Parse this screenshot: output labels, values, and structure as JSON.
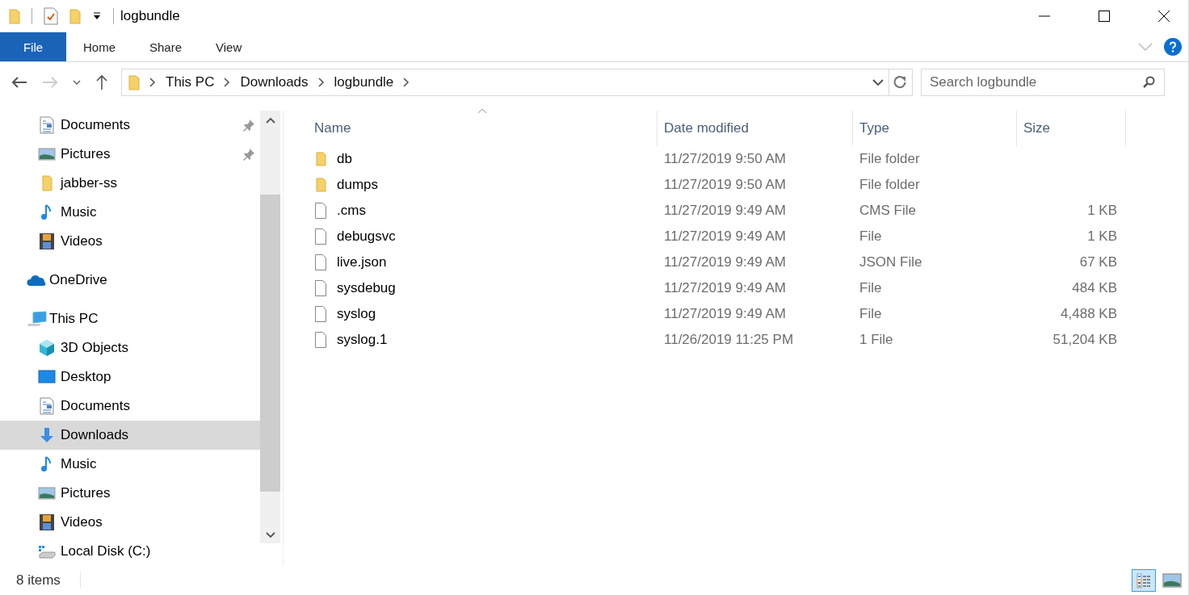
{
  "window": {
    "title": "logbundle"
  },
  "ribbon": {
    "tabs": [
      {
        "label": "File",
        "selected": true
      },
      {
        "label": "Home",
        "selected": false
      },
      {
        "label": "Share",
        "selected": false
      },
      {
        "label": "View",
        "selected": false
      }
    ]
  },
  "address": {
    "crumbs": [
      "This PC",
      "Downloads",
      "logbundle"
    ]
  },
  "search": {
    "placeholder": "Search logbundle"
  },
  "sidebar": {
    "items": [
      {
        "label": "Documents",
        "kind": "documents",
        "pinned": true,
        "selected": false
      },
      {
        "label": "Pictures",
        "kind": "pictures",
        "pinned": true,
        "selected": false
      },
      {
        "label": "jabber-ss",
        "kind": "folder",
        "pinned": false,
        "selected": false
      },
      {
        "label": "Music",
        "kind": "music",
        "pinned": false,
        "selected": false
      },
      {
        "label": "Videos",
        "kind": "videos",
        "pinned": false,
        "selected": false
      }
    ],
    "roots": [
      {
        "label": "OneDrive",
        "kind": "cloud",
        "selected": false
      },
      {
        "label": "This PC",
        "kind": "computer",
        "selected": false,
        "children": [
          {
            "label": "3D Objects",
            "kind": "cube",
            "selected": false
          },
          {
            "label": "Desktop",
            "kind": "desktop",
            "selected": false
          },
          {
            "label": "Documents",
            "kind": "documents",
            "selected": false
          },
          {
            "label": "Downloads",
            "kind": "downloads",
            "selected": true
          },
          {
            "label": "Music",
            "kind": "music",
            "selected": false
          },
          {
            "label": "Pictures",
            "kind": "pictures",
            "selected": false
          },
          {
            "label": "Videos",
            "kind": "videos",
            "selected": false
          },
          {
            "label": "Local Disk (C:)",
            "kind": "drive",
            "selected": false
          }
        ]
      }
    ]
  },
  "table": {
    "columns": [
      "Name",
      "Date modified",
      "Type",
      "Size"
    ],
    "rows": [
      {
        "name": "db",
        "date": "11/27/2019 9:50 AM",
        "type": "File folder",
        "kind": "folder"
      },
      {
        "name": "dumps",
        "date": "11/27/2019 9:50 AM",
        "type": "File folder",
        "kind": "folder"
      },
      {
        "name": ".cms",
        "date": "11/27/2019 9:49 AM",
        "type": "CMS File",
        "size": "1 KB",
        "kind": "file"
      },
      {
        "name": "debugsvc",
        "date": "11/27/2019 9:49 AM",
        "type": "File",
        "size": "1 KB",
        "kind": "file"
      },
      {
        "name": "live.json",
        "date": "11/27/2019 9:49 AM",
        "type": "JSON File",
        "size": "67 KB",
        "kind": "file"
      },
      {
        "name": "sysdebug",
        "date": "11/27/2019 9:49 AM",
        "type": "File",
        "size": "484 KB",
        "kind": "file"
      },
      {
        "name": "syslog",
        "date": "11/27/2019 9:49 AM",
        "type": "File",
        "size": "4,488 KB",
        "kind": "file"
      },
      {
        "name": "syslog.1",
        "date": "11/26/2019 11:25 PM",
        "type": "1 File",
        "size": "51,204 KB",
        "kind": "file"
      }
    ]
  },
  "status_bar": {
    "count": "8 items",
    "views": [
      {
        "kind": "details",
        "selected": true
      },
      {
        "kind": "thumbnails",
        "selected": false
      }
    ]
  }
}
